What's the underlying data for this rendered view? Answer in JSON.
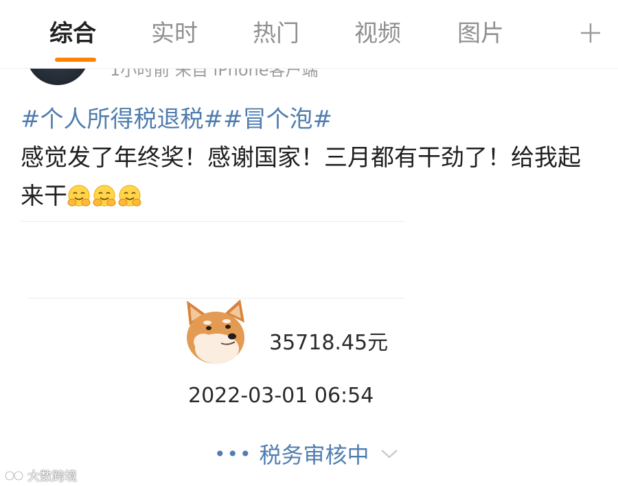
{
  "tabs": [
    {
      "label": "综合",
      "active": true
    },
    {
      "label": "实时",
      "active": false
    },
    {
      "label": "热门",
      "active": false
    },
    {
      "label": "视频",
      "active": false
    },
    {
      "label": "图片",
      "active": false
    }
  ],
  "accent_color": "#ff8200",
  "link_color": "#507daf",
  "post": {
    "meta": "1小时前 来自 iPhone客户端",
    "topics": "#个人所得税退税##冒个泡#",
    "text": "感觉发了年终奖！感谢国家！三月都有干劲了！给我起来干",
    "emoji_names": [
      "hug-emoji",
      "hug-emoji",
      "hug-emoji"
    ]
  },
  "refund_card": {
    "amount": "35718.45元",
    "timestamp": "2022-03-01 06:54",
    "status_dots": "•••",
    "status_text": "税务审核中"
  },
  "watermark": "大数跨境"
}
